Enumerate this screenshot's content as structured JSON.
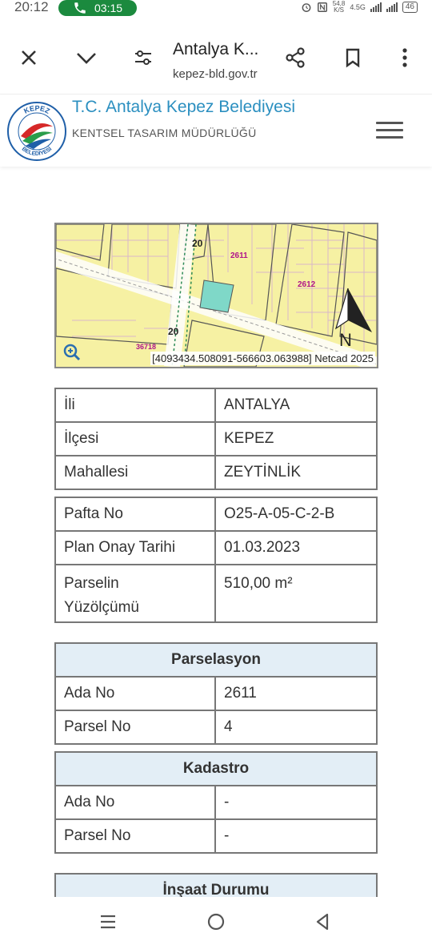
{
  "status_bar": {
    "time": "20:12",
    "call_timer": "03:15",
    "net_speed_value": "54,8",
    "net_speed_unit": "K/S",
    "network": "4.5G",
    "battery": "46"
  },
  "browser": {
    "page_title": "Antalya K...",
    "url": "kepez-bld.gov.tr",
    "icons": [
      "close-icon",
      "chevron-down-icon",
      "tune-icon",
      "share-icon",
      "bookmark-icon",
      "more-vert-icon"
    ]
  },
  "site": {
    "title": "T.C. Antalya Kepez Belediyesi",
    "subtitle": "KENTSEL TASARIM MÜDÜRLÜĞÜ",
    "logo_text_top": "KEPEZ",
    "logo_text_bottom": "BELEDİYESİ"
  },
  "map": {
    "coords": "[4093434.508091-566603.063988] Netcad 2025",
    "north_label": "N",
    "labels": [
      "20",
      "20",
      "2611",
      "2612",
      "36718"
    ]
  },
  "location_table": [
    {
      "key": "İli",
      "value": "ANTALYA"
    },
    {
      "key": "İlçesi",
      "value": "KEPEZ"
    },
    {
      "key": "Mahallesi",
      "value": "ZEYTİNLİK"
    }
  ],
  "plan_table": [
    {
      "key": "Pafta No",
      "value": "O25-A-05-C-2-B"
    },
    {
      "key": "Plan Onay Tarihi",
      "value": "01.03.2023"
    },
    {
      "key": "Parselin Yüzölçümü",
      "value": "510,00 m²"
    }
  ],
  "parselasyon": {
    "title": "Parselasyon",
    "rows": [
      {
        "key": "Ada No",
        "value": "2611"
      },
      {
        "key": "Parsel No",
        "value": "4"
      }
    ]
  },
  "kadastro": {
    "title": "Kadastro",
    "rows": [
      {
        "key": "Ada No",
        "value": "-"
      },
      {
        "key": "Parsel No",
        "value": "-"
      }
    ]
  },
  "insaat": {
    "title": "İnşaat Durumu"
  },
  "colors": {
    "accent": "#2b8fc0",
    "call_green": "#1b8a3e",
    "table_header_bg": "#e3eef6",
    "map_yellow": "#f7f2a8"
  }
}
